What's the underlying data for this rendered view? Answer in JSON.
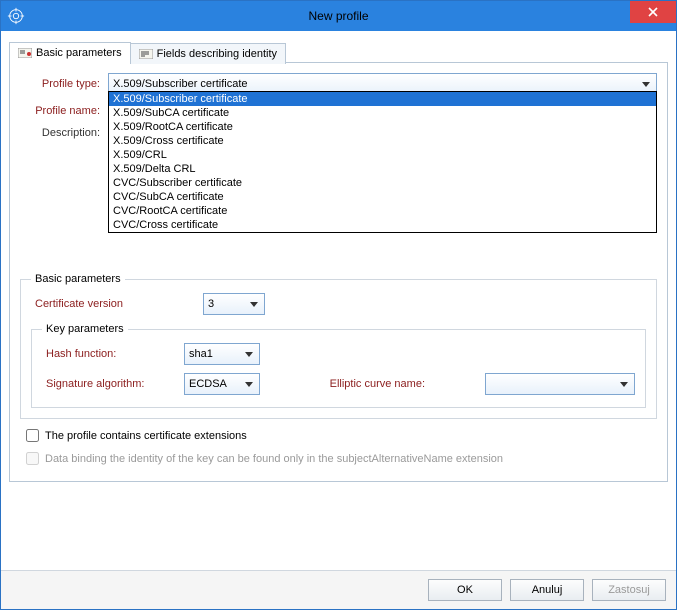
{
  "window": {
    "title": "New profile"
  },
  "tabs": {
    "basic": "Basic parameters",
    "identity": "Fields describing identity"
  },
  "form": {
    "profile_type_label": "Profile type:",
    "profile_name_label": "Profile name:",
    "description_label": "Description:",
    "profile_type_value": "X.509/Subscriber certificate",
    "options": [
      "X.509/Subscriber certificate",
      "X.509/SubCA certificate",
      "X.509/RootCA certificate",
      "X.509/Cross certificate",
      "X.509/CRL",
      "X.509/Delta CRL",
      "CVC/Subscriber certificate",
      "CVC/SubCA certificate",
      "CVC/RootCA certificate",
      "CVC/Cross certificate"
    ]
  },
  "basic_fs": {
    "legend": "Basic parameters",
    "cert_version_label": "Certificate version",
    "cert_version_value": "3",
    "key_legend": "Key parameters",
    "hash_label": "Hash function:",
    "hash_value": "sha1",
    "sig_label": "Signature algorithm:",
    "sig_value": "ECDSA",
    "curve_label": "Elliptic curve name:",
    "curve_value": ""
  },
  "checks": {
    "ext_label": "The profile contains certificate extensions",
    "bind_label": "Data binding the identity of the key can be found only in the subjectAlternativeName extension"
  },
  "buttons": {
    "ok": "OK",
    "cancel": "Anuluj",
    "apply": "Zastosuj"
  }
}
